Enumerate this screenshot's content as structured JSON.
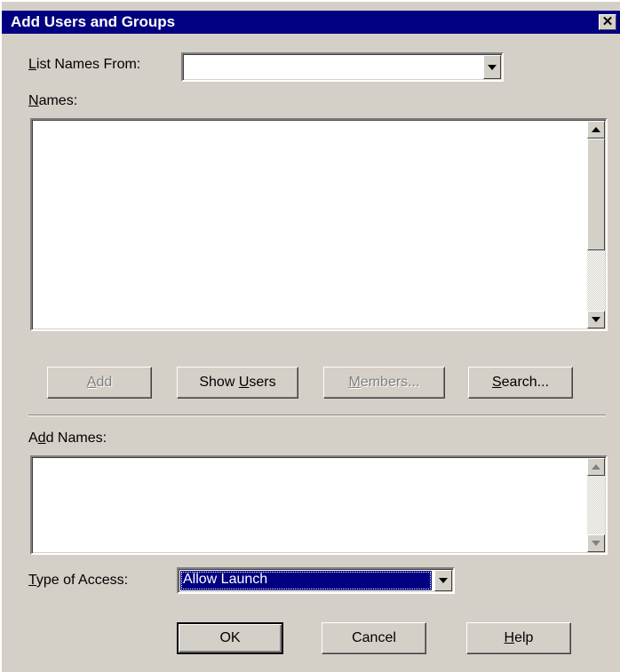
{
  "window": {
    "title": "Add Users and Groups",
    "close_glyph": "✕"
  },
  "list_names_from": {
    "label_accel": "L",
    "label_rest": "ist Names From:",
    "value": ""
  },
  "names": {
    "label_accel": "N",
    "label_rest": "ames:"
  },
  "buttons": {
    "add": {
      "accel": "A",
      "rest": "dd"
    },
    "show_users": {
      "pre": "Show ",
      "accel": "U",
      "rest": "sers"
    },
    "members": {
      "accel": "M",
      "rest": "embers..."
    },
    "search": {
      "accel": "S",
      "rest": "earch..."
    }
  },
  "add_names": {
    "label_pre": "A",
    "label_accel": "d",
    "label_rest": "d Names:"
  },
  "type_of_access": {
    "label_accel": "T",
    "label_rest": "ype of Access:",
    "value": "Allow Launch"
  },
  "footer": {
    "ok": "OK",
    "cancel": "Cancel",
    "help": {
      "accel": "H",
      "rest": "elp"
    }
  },
  "colors": {
    "titlebar": "#000080",
    "face": "#d4d0c8",
    "selection": "#000080"
  },
  "icons": [
    "close-icon",
    "dropdown-arrow-icon",
    "scroll-up-icon",
    "scroll-down-icon"
  ]
}
